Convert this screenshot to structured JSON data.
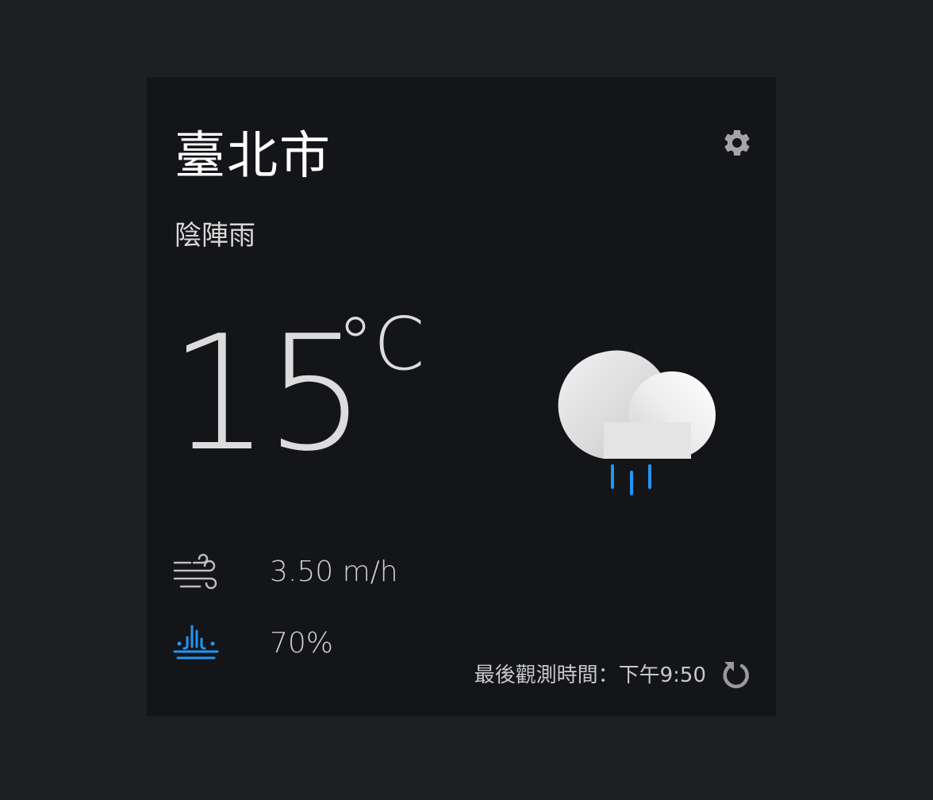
{
  "location": {
    "city": "臺北市"
  },
  "weather": {
    "description": "陰陣雨",
    "temperature": "15",
    "unit": "°C",
    "icon": "cloud-moon-rain-icon"
  },
  "details": {
    "wind_speed": "3.50 m/h",
    "rain_probability": "70%"
  },
  "footer": {
    "last_observed": "最後觀測時間：下午9:50"
  },
  "colors": {
    "background": "#1e1f21",
    "card": "#141518",
    "moon": "#f0c419",
    "rain": "#2196f3",
    "icon_gray": "#a0a0a0"
  }
}
